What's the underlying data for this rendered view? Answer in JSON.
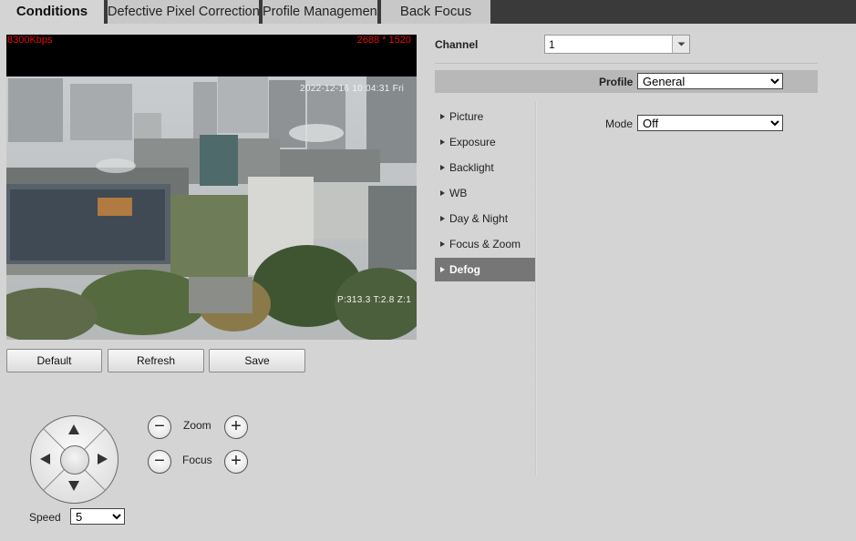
{
  "tabs": [
    {
      "label": "Conditions",
      "active": true
    },
    {
      "label": "Defective Pixel Correction",
      "active": false
    },
    {
      "label": "Profile Management",
      "active": false
    },
    {
      "label": "Back Focus",
      "active": false
    }
  ],
  "video": {
    "bitrate": "8300Kbps",
    "resolution": "2688 * 1520",
    "timestamp": "2022-12-16 10:04:31 Fri",
    "ptz_status": "P:313.3 T:2.8 Z:1"
  },
  "actions": {
    "default": "Default",
    "refresh": "Refresh",
    "save": "Save"
  },
  "ptz": {
    "zoom_label": "Zoom",
    "focus_label": "Focus",
    "speed_label": "Speed",
    "speed_value": "5",
    "minus": "−",
    "plus": "+"
  },
  "settings": {
    "channel_label": "Channel",
    "channel_value": "1",
    "profile_label": "Profile",
    "profile_value": "General",
    "mode_label": "Mode",
    "mode_value": "Off"
  },
  "menu": [
    {
      "label": "Picture",
      "active": false
    },
    {
      "label": "Exposure",
      "active": false
    },
    {
      "label": "Backlight",
      "active": false
    },
    {
      "label": "WB",
      "active": false
    },
    {
      "label": "Day & Night",
      "active": false
    },
    {
      "label": "Focus & Zoom",
      "active": false
    },
    {
      "label": "Defog",
      "active": true
    }
  ],
  "colors": {
    "tab_bar": "#3a3a3a",
    "active_menu": "#767676",
    "osd_red": "#e01010",
    "background": "#d4d4d4"
  }
}
